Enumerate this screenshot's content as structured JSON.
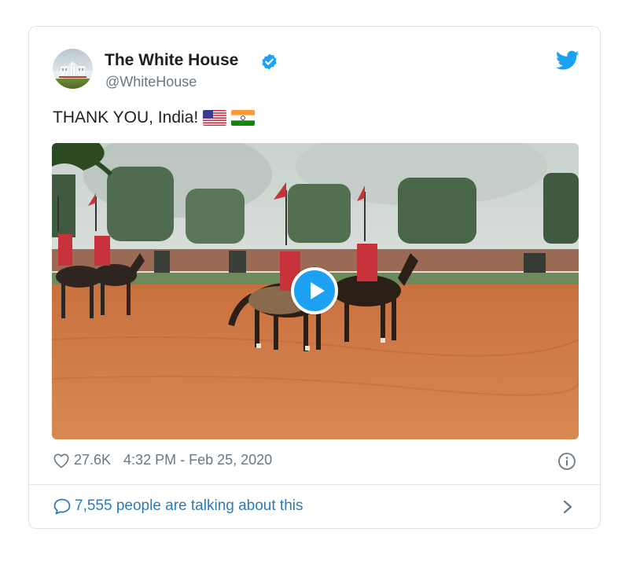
{
  "tweet": {
    "author_name": "The White House",
    "author_handle": "@WhiteHouse",
    "text": "THANK YOU, India!",
    "flags": [
      "us-flag",
      "india-flag"
    ],
    "media": {
      "type": "video",
      "description_icon": "play-icon"
    },
    "likes": "27.6K",
    "timestamp": "4:32 PM - Feb 25, 2020",
    "talking": "7,555 people are talking about this"
  },
  "colors": {
    "brand_blue": "#1da1f2",
    "link_blue": "#2b7bb9",
    "muted_text": "#697882",
    "card_border": "#dfe3e6"
  }
}
